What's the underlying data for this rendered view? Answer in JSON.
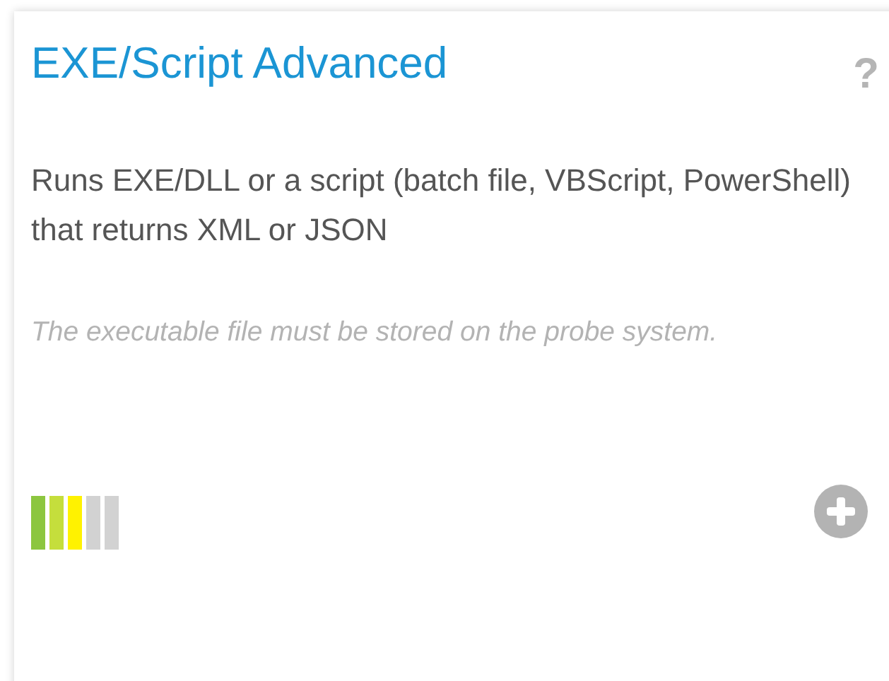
{
  "card": {
    "title": "EXE/Script Advanced",
    "help": "?",
    "description": "Runs EXE/DLL or a script (batch file, VBScript, PowerShell) that returns XML or JSON",
    "note": "The executable file must be stored on the probe system.",
    "impact": {
      "level": 0.6
    }
  }
}
